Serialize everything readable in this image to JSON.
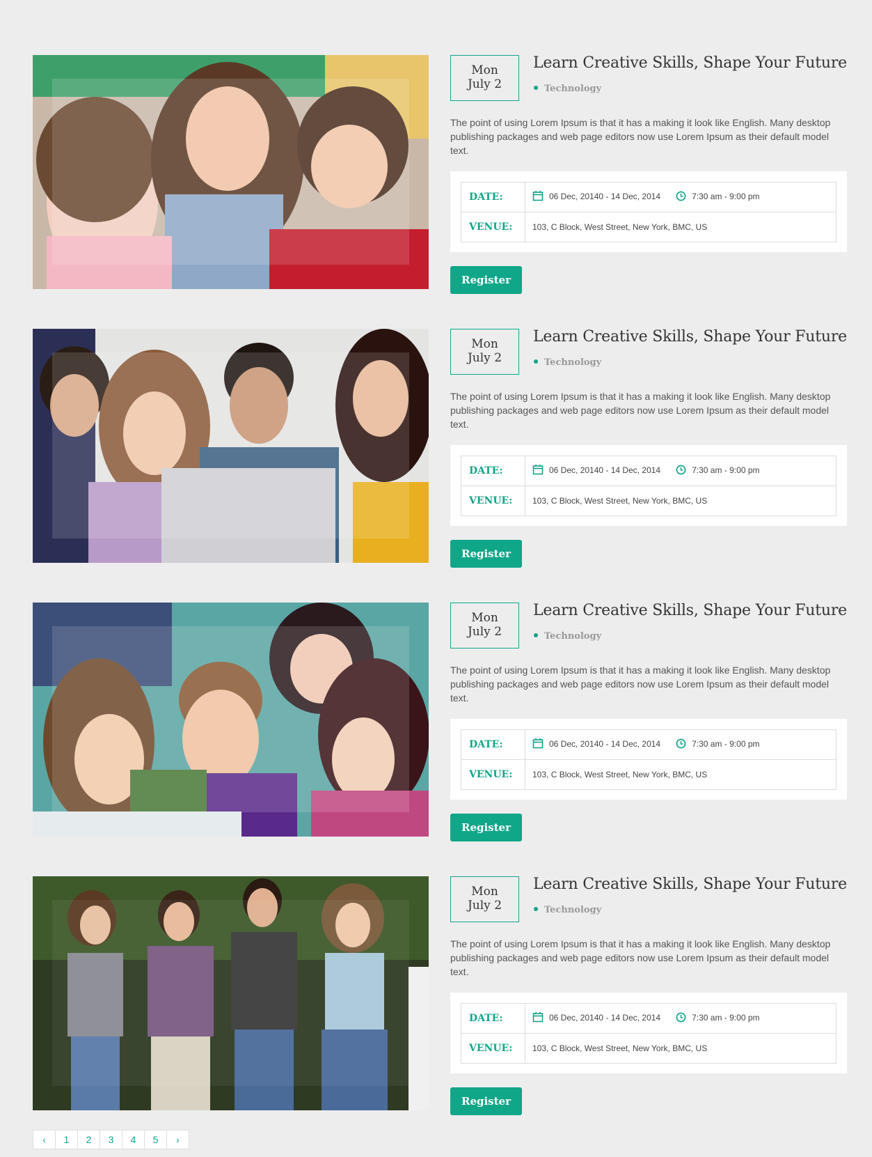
{
  "events": [
    {
      "date": {
        "weekday": "Mon",
        "day": "July 2"
      },
      "title": "Learn Creative Skills, Shape Your Future",
      "category": "Technology",
      "description": "The point of using Lorem Ipsum is that it has a making it look like English. Many desktop publishing packages and web page editors now use Lorem Ipsum as their default model text.",
      "date_label": "DATE:",
      "date_range": "06 Dec, 20140 - 14 Dec, 2014",
      "time_range": "7:30 am - 9:00 pm",
      "venue_label": "VENUE:",
      "venue": "103, C Block, West Street, New York, BMC, US",
      "register_label": "Register"
    },
    {
      "date": {
        "weekday": "Mon",
        "day": "July 2"
      },
      "title": "Learn Creative Skills, Shape Your Future",
      "category": "Technology",
      "description": "The point of using Lorem Ipsum is that it has a making it look like English. Many desktop publishing packages and web page editors now use Lorem Ipsum as their default model text.",
      "date_label": "DATE:",
      "date_range": "06 Dec, 20140 - 14 Dec, 2014",
      "time_range": "7:30 am - 9:00 pm",
      "venue_label": "VENUE:",
      "venue": "103, C Block, West Street, New York, BMC, US",
      "register_label": "Register"
    },
    {
      "date": {
        "weekday": "Mon",
        "day": "July 2"
      },
      "title": "Learn Creative Skills, Shape Your Future",
      "category": "Technology",
      "description": "The point of using Lorem Ipsum is that it has a making it look like English. Many desktop publishing packages and web page editors now use Lorem Ipsum as their default model text.",
      "date_label": "DATE:",
      "date_range": "06 Dec, 20140 - 14 Dec, 2014",
      "time_range": "7:30 am - 9:00 pm",
      "venue_label": "VENUE:",
      "venue": "103, C Block, West Street, New York, BMC, US",
      "register_label": "Register"
    },
    {
      "date": {
        "weekday": "Mon",
        "day": "July 2"
      },
      "title": "Learn Creative Skills, Shape Your Future",
      "category": "Technology",
      "description": "The point of using Lorem Ipsum is that it has a making it look like English. Many desktop publishing packages and web page editors now use Lorem Ipsum as their default model text.",
      "date_label": "DATE:",
      "date_range": "06 Dec, 20140 - 14 Dec, 2014",
      "time_range": "7:30 am - 9:00 pm",
      "venue_label": "VENUE:",
      "venue": "103, C Block, West Street, New York, BMC, US",
      "register_label": "Register"
    }
  ],
  "pagination": {
    "prev": "‹",
    "pages": [
      "1",
      "2",
      "3",
      "4",
      "5"
    ],
    "next": "›"
  },
  "colors": {
    "accent": "#10a688",
    "background": "#ededed"
  },
  "icons": {
    "date": "calendar-icon",
    "time": "clock-icon"
  }
}
